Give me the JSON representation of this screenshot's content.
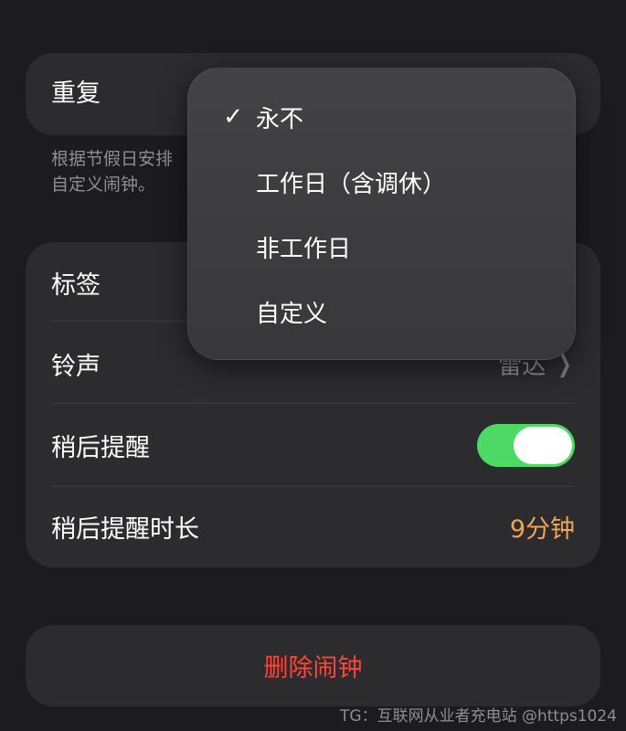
{
  "repeat": {
    "label": "重复",
    "footnote_line1": "根据节假日安排",
    "footnote_line2": "自定义闹钟。"
  },
  "settings": {
    "label_row": {
      "label": "标签"
    },
    "ringtone_row": {
      "label": "铃声",
      "value": "雷达"
    },
    "snooze_row": {
      "label": "稍后提醒",
      "enabled": true
    },
    "snooze_duration_row": {
      "label": "稍后提醒时长",
      "value": "9分钟"
    }
  },
  "delete_button": {
    "label": "删除闹钟"
  },
  "dropdown": {
    "selected_index": 0,
    "items": [
      {
        "label": "永不",
        "checked": true
      },
      {
        "label": "工作日（含调休）",
        "checked": false
      },
      {
        "label": "非工作日",
        "checked": false
      },
      {
        "label": "自定义",
        "checked": false
      }
    ],
    "check_glyph": "✓"
  },
  "watermark": "TG：互联网从业者充电站 @https1024",
  "colors": {
    "background": "#1c1c1e",
    "card": "#2c2c2e",
    "toggle_on": "#4cd964",
    "accent_orange": "#f0a35a",
    "destructive": "#ff453a",
    "secondary_text": "#8e8e93"
  },
  "icons": {
    "chevron": "chevron-right-icon",
    "check": "checkmark-icon"
  }
}
